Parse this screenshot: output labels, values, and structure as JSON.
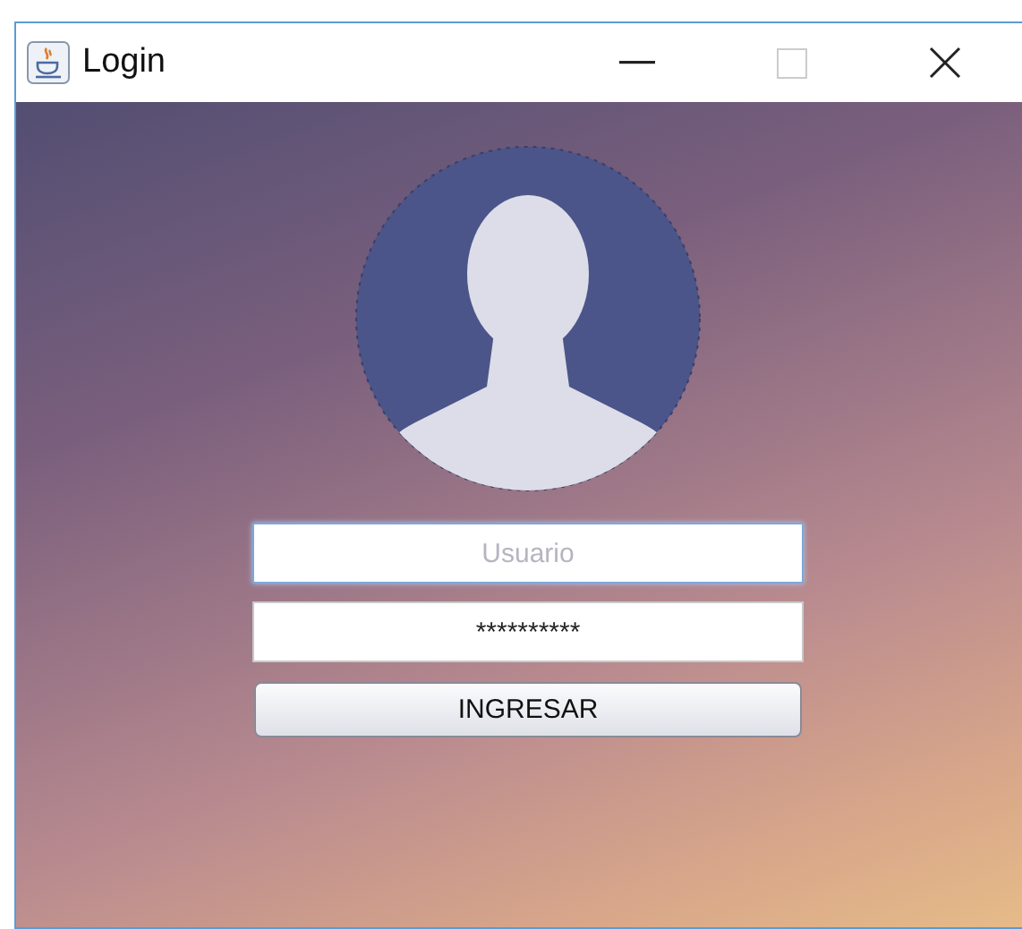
{
  "window": {
    "title": "Login"
  },
  "form": {
    "username": {
      "placeholder": "Usuario",
      "focused": true
    },
    "password": {
      "value": "**********"
    },
    "submit": {
      "label": "INGRESAR"
    }
  }
}
